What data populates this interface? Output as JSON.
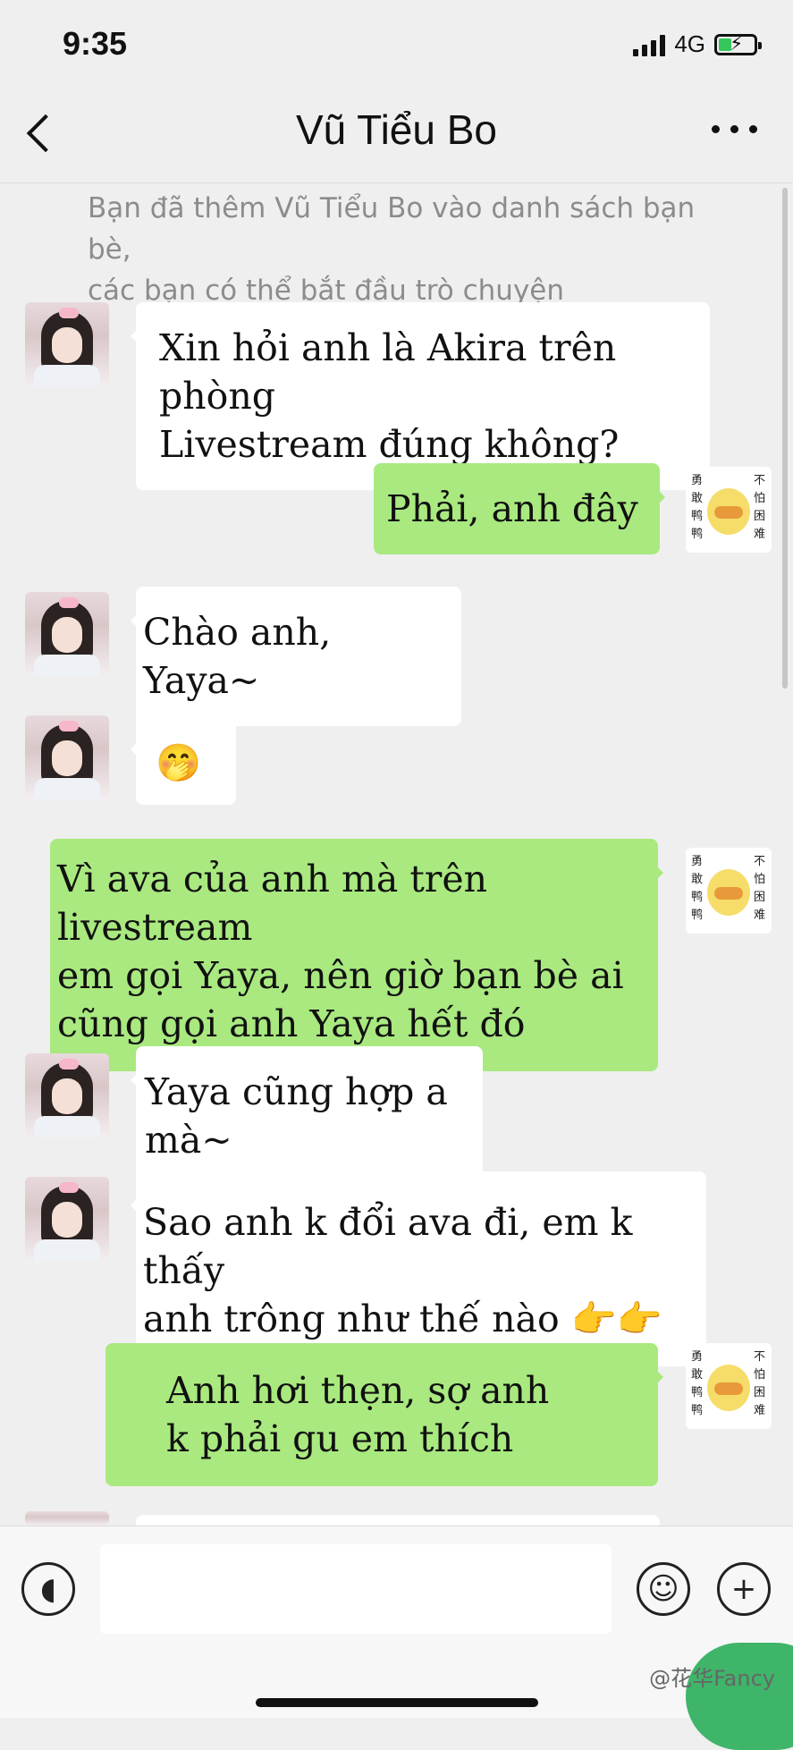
{
  "status_bar": {
    "time": "9:35",
    "network": "4G"
  },
  "header": {
    "title": "Vũ Tiểu Bo"
  },
  "system_message": "Bạn đã thêm Vũ Tiểu Bo vào danh sách bạn bè,\ncác bạn có thể bắt đầu trò chuyện",
  "sticker_text": {
    "left": "勇敢鸭鸭",
    "right": "不怕困难"
  },
  "messages": [
    {
      "side": "in",
      "text": "Xin hỏi anh là Akira trên phòng\nLivestream đúng không?"
    },
    {
      "side": "out",
      "text": "Phải, anh đây"
    },
    {
      "side": "in",
      "text": "Chào anh, Yaya~"
    },
    {
      "side": "in",
      "text": "🤭"
    },
    {
      "side": "out",
      "text": "Vì ava của anh mà trên livestream\nem gọi Yaya, nên giờ bạn bè ai\ncũng gọi anh Yaya hết đó"
    },
    {
      "side": "in",
      "text": "Yaya cũng hợp a mà~"
    },
    {
      "side": "in",
      "text": "Sao anh k đổi ava đi, em k thấy\nanh trông như thế nào 👉👉"
    },
    {
      "side": "out",
      "text": "Anh hơi thẹn, sợ anh\nk phải gu em thích"
    }
  ],
  "input_bar": {
    "icons": {
      "voice": "voice-icon",
      "emoji": "emoji-icon",
      "plus": "plus-icon"
    },
    "value": ""
  },
  "watermark_credit": "@花华Fancy"
}
